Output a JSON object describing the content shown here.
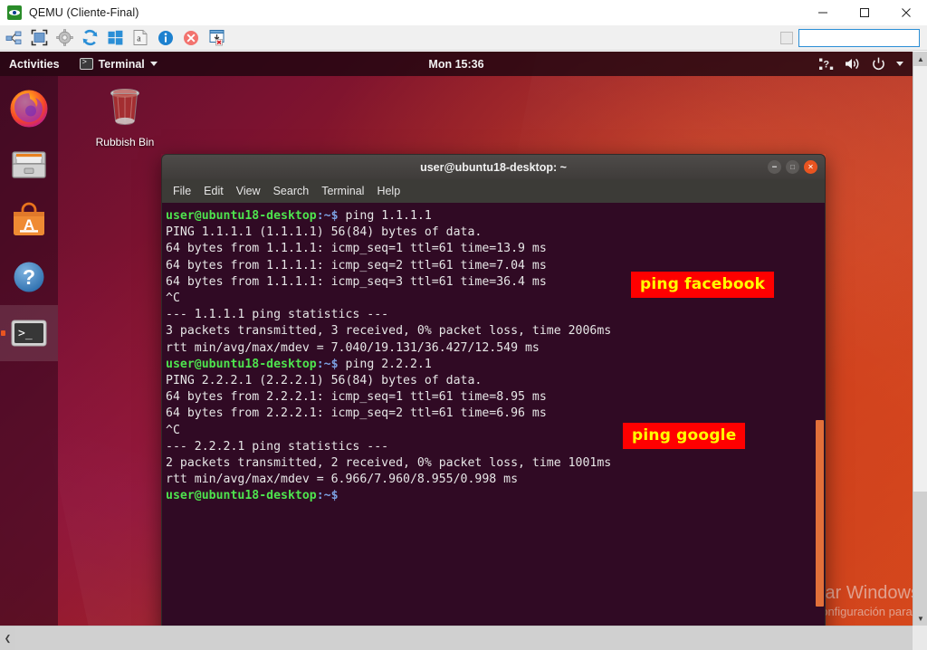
{
  "host_window": {
    "title": "QEMU (Cliente-Final)",
    "app_icon": "qemu-icon",
    "controls": [
      {
        "name": "minimize",
        "glyph": "—"
      },
      {
        "name": "maximize",
        "glyph": "□"
      },
      {
        "name": "close",
        "glyph": "✕"
      }
    ]
  },
  "qemu_toolbar": {
    "icons": [
      "network-icon",
      "fullscreen-icon",
      "settings-gear-icon",
      "refresh-icon",
      "windows-start-icon",
      "text-document-icon",
      "info-icon",
      "cancel-icon",
      "window-close-doc-icon"
    ],
    "checkbox_name": "toolbar-checkbox",
    "input_value": "",
    "input_placeholder": ""
  },
  "topbar": {
    "activities": "Activities",
    "app_menu": "Terminal",
    "app_menu_icon": "terminal-icon",
    "caret_icon": "chevron-down-icon",
    "clock": "Mon 15:36",
    "tray": [
      "keyboard-input-icon",
      "volume-icon",
      "power-icon",
      "chevron-down-icon"
    ]
  },
  "dock": {
    "items": [
      {
        "name": "firefox",
        "label": "Firefox",
        "icon": "firefox-icon",
        "active": false
      },
      {
        "name": "files",
        "label": "Files",
        "icon": "file-cabinet-icon",
        "active": false
      },
      {
        "name": "software",
        "label": "Ubuntu Software",
        "icon": "ubuntu-software-icon",
        "active": false
      },
      {
        "name": "help",
        "label": "Help",
        "icon": "help-question-icon",
        "active": false
      },
      {
        "name": "terminal",
        "label": "Terminal",
        "icon": "terminal-icon",
        "active": true
      }
    ]
  },
  "desktop": {
    "trash_label": "Rubbish Bin",
    "trash_icon": "rubbish-bin-icon"
  },
  "terminal": {
    "title": "user@ubuntu18-desktop: ~",
    "menu": [
      "File",
      "Edit",
      "View",
      "Search",
      "Terminal",
      "Help"
    ],
    "window_buttons": [
      "minimize",
      "maximize",
      "close"
    ],
    "lines": [
      {
        "prompt": "user@ubuntu18-desktop",
        "path": ":~$",
        "text": " ping 1.1.1.1"
      },
      {
        "text": "PING 1.1.1.1 (1.1.1.1) 56(84) bytes of data."
      },
      {
        "text": "64 bytes from 1.1.1.1: icmp_seq=1 ttl=61 time=13.9 ms"
      },
      {
        "text": "64 bytes from 1.1.1.1: icmp_seq=2 ttl=61 time=7.04 ms"
      },
      {
        "text": "64 bytes from 1.1.1.1: icmp_seq=3 ttl=61 time=36.4 ms"
      },
      {
        "text": "^C"
      },
      {
        "text": "--- 1.1.1.1 ping statistics ---"
      },
      {
        "text": "3 packets transmitted, 3 received, 0% packet loss, time 2006ms"
      },
      {
        "text": "rtt min/avg/max/mdev = 7.040/19.131/36.427/12.549 ms"
      },
      {
        "prompt": "user@ubuntu18-desktop",
        "path": ":~$",
        "text": " ping 2.2.2.1"
      },
      {
        "text": "PING 2.2.2.1 (2.2.2.1) 56(84) bytes of data."
      },
      {
        "text": "64 bytes from 2.2.2.1: icmp_seq=1 ttl=61 time=8.95 ms"
      },
      {
        "text": "64 bytes from 2.2.2.1: icmp_seq=2 ttl=61 time=6.96 ms"
      },
      {
        "text": "^C"
      },
      {
        "text": "--- 2.2.2.1 ping statistics ---"
      },
      {
        "text": "2 packets transmitted, 2 received, 0% packet loss, time 1001ms"
      },
      {
        "text": "rtt min/avg/max/mdev = 6.966/7.960/8.955/0.998 ms"
      },
      {
        "prompt": "user@ubuntu18-desktop",
        "path": ":~$",
        "text": ""
      }
    ]
  },
  "annotations": [
    {
      "name": "annot-ping-facebook",
      "text": "ping facebook"
    },
    {
      "name": "annot-ping-google",
      "text": "ping google"
    }
  ],
  "watermark": {
    "line1": "Activar Windows",
    "line2": "Ve a Configuración para"
  },
  "scrollbars": {
    "up": "▲",
    "down": "▼",
    "left": "❮",
    "right": "❯"
  },
  "colors": {
    "terminal_bg": "#300a24",
    "ubuntu_orange": "#e95420",
    "annotation_bg": "#ff0000",
    "annotation_fg": "#ffff00",
    "prompt_green": "#4ee44e",
    "path_blue": "#7b9fe0"
  }
}
